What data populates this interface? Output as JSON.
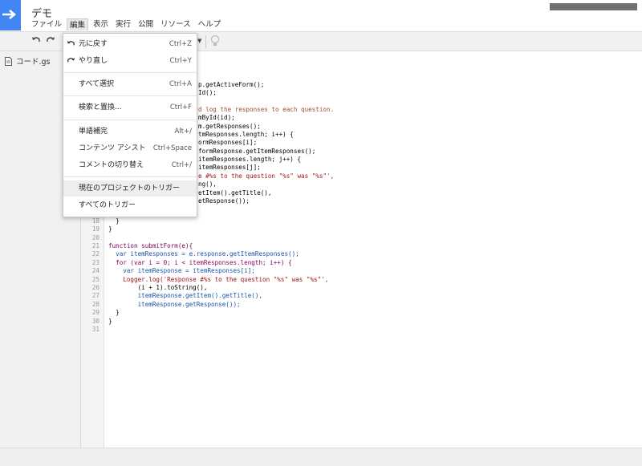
{
  "app": {
    "title": "デモ",
    "menu": [
      "ファイル",
      "編集",
      "表示",
      "実行",
      "公開",
      "リソース",
      "ヘルプ"
    ],
    "active_menu_index": 1
  },
  "toolbar": {
    "undo_icon": "undo-icon",
    "redo_icon": "redo-icon",
    "bulb_icon": "lightbulb-icon"
  },
  "sidebar": {
    "files": [
      {
        "name": "コード.gs",
        "icon": "file-icon"
      }
    ]
  },
  "dropdown": {
    "items": [
      {
        "label": "元に戻す",
        "shortcut": "Ctrl+Z",
        "icon": "undo-icon"
      },
      {
        "label": "やり直し",
        "shortcut": "Ctrl+Y",
        "icon": "redo-icon"
      },
      {
        "label": "すべて選択",
        "shortcut": "Ctrl+A"
      },
      {
        "label": "検索と置換...",
        "shortcut": "Ctrl+F"
      },
      {
        "label": "単語補完",
        "shortcut": "Alt+/"
      },
      {
        "label": "コンテンツ アシスト",
        "shortcut": "Ctrl+Space"
      },
      {
        "label": "コメントの切り替え",
        "shortcut": "Ctrl+/"
      },
      {
        "label": "現在のプロジェクトのトリガー",
        "shortcut": "",
        "highlighted": true
      },
      {
        "label": "すべてのトリガー",
        "shortcut": ""
      }
    ]
  },
  "editor": {
    "line_numbers": [
      "18",
      "19",
      "20",
      "21",
      "22",
      "23",
      "24",
      "25",
      "26",
      "27",
      "28",
      "29",
      "30",
      "31"
    ],
    "visible_code_fragments": [
      "p.getActiveForm();",
      "Id();",
      "d log the responses to each question.",
      "mById(id);",
      "m.getResponses();",
      "tmResponses.length; i++) {",
      "ormResponses[i];",
      "formResponse.getItemResponses();",
      "itemResponses.length; j++) {",
      "itemResponses[j];",
      "e #%s to the question \"%s\" was \"%s\"',",
      "ng(),",
      "etItem().getTitle(),",
      "etResponse());"
    ],
    "code_lines": [
      "  }",
      "}",
      "",
      "function submitForm(e){",
      "  var itemResponses = e.response.getItemResponses();",
      "  for (var i = 0; i < itemResponses.length; i++) {",
      "    var itemResponse = itemResponses[i];",
      "    Logger.log('Response #%s to the question \"%s\" was \"%s\"',",
      "        (i + 1).toString(),",
      "        itemResponse.getItem().getTitle(),",
      "        itemResponse.getResponse());",
      "  }",
      "}",
      ""
    ]
  },
  "colors": {
    "brand": "#4285f4",
    "keyword": "#7f0055",
    "string": "#a31515",
    "variable": "#1a53a8",
    "comment": "#a0522d"
  }
}
